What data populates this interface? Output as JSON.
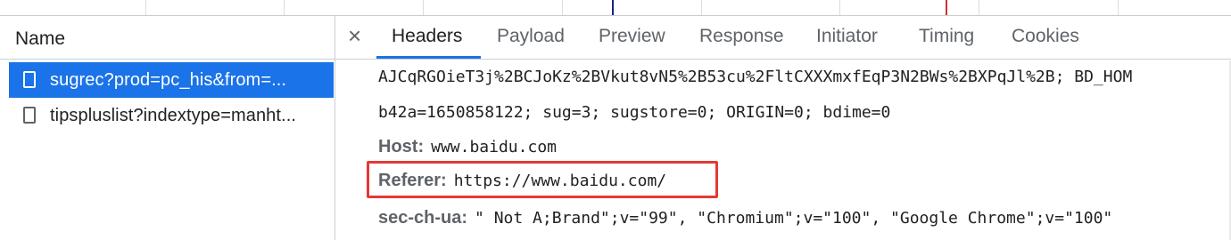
{
  "colors": {
    "accent": "#1a73e8",
    "highlight": "#e53935",
    "timeline_marker_blue": "#1a237e",
    "timeline_marker_red": "#d32f2f"
  },
  "left_pane": {
    "column_header": "Name",
    "requests": [
      {
        "label": "sugrec?prod=pc_his&from=...",
        "icon": "document-icon",
        "selected": true
      },
      {
        "label": "tipspluslist?indextype=manht...",
        "icon": "document-icon",
        "selected": false
      }
    ]
  },
  "detail": {
    "close_icon": "close-icon",
    "close_glyph": "×",
    "tabs": [
      {
        "label": "Headers",
        "active": true
      },
      {
        "label": "Payload",
        "active": false
      },
      {
        "label": "Preview",
        "active": false
      },
      {
        "label": "Response",
        "active": false
      },
      {
        "label": "Initiator",
        "active": false
      },
      {
        "label": "Timing",
        "active": false
      },
      {
        "label": "Cookies",
        "active": false
      }
    ],
    "headers": {
      "cookie_line1": "AJCqRGOieT3j%2BCJoKz%2BVkut8vN5%2B53cu%2FltCXXXmxfEqP3N2BWs%2BXPqJl%2B; BD_HOM",
      "cookie_line2": "b42a=1650858122; sug=3; sugstore=0; ORIGIN=0; bdime=0",
      "host_name": "Host:",
      "host_value": "www.baidu.com",
      "referer_name": "Referer:",
      "referer_value": "https://www.baidu.com/",
      "sec_ch_ua_name": "sec-ch-ua:",
      "sec_ch_ua_value": "\" Not A;Brand\";v=\"99\", \"Chromium\";v=\"100\", \"Google Chrome\";v=\"100\""
    }
  }
}
